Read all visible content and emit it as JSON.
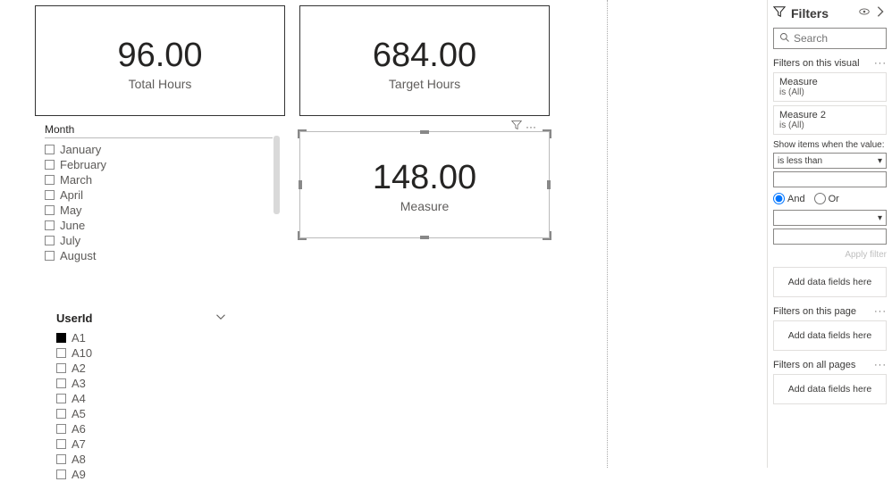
{
  "cards": {
    "total_hours": {
      "value": "96.00",
      "label": "Total Hours"
    },
    "target_hours": {
      "value": "684.00",
      "label": "Target Hours"
    },
    "measure": {
      "value": "148.00",
      "label": "Measure"
    }
  },
  "slicers": {
    "month": {
      "title": "Month",
      "items": [
        "January",
        "February",
        "March",
        "April",
        "May",
        "June",
        "July",
        "August"
      ]
    },
    "userid": {
      "title": "UserId",
      "items": [
        {
          "label": "A1",
          "checked": true
        },
        {
          "label": "A10",
          "checked": false
        },
        {
          "label": "A2",
          "checked": false
        },
        {
          "label": "A3",
          "checked": false
        },
        {
          "label": "A4",
          "checked": false
        },
        {
          "label": "A5",
          "checked": false
        },
        {
          "label": "A6",
          "checked": false
        },
        {
          "label": "A7",
          "checked": false
        },
        {
          "label": "A8",
          "checked": false
        },
        {
          "label": "A9",
          "checked": false
        }
      ]
    }
  },
  "filters": {
    "pane_title": "Filters",
    "search_placeholder": "Search",
    "sections": {
      "visual": "Filters on this visual",
      "page": "Filters on this page",
      "all": "Filters on all pages"
    },
    "visual_filters": [
      {
        "name": "Measure",
        "state": "is (All)"
      },
      {
        "name": "Measure 2",
        "state": "is (All)"
      }
    ],
    "condition": {
      "prompt": "Show items when the value:",
      "op1": "is less than",
      "logic": "And",
      "logic_options": {
        "and": "And",
        "or": "Or"
      }
    },
    "apply": "Apply filter",
    "drop_hint": "Add data fields here"
  }
}
